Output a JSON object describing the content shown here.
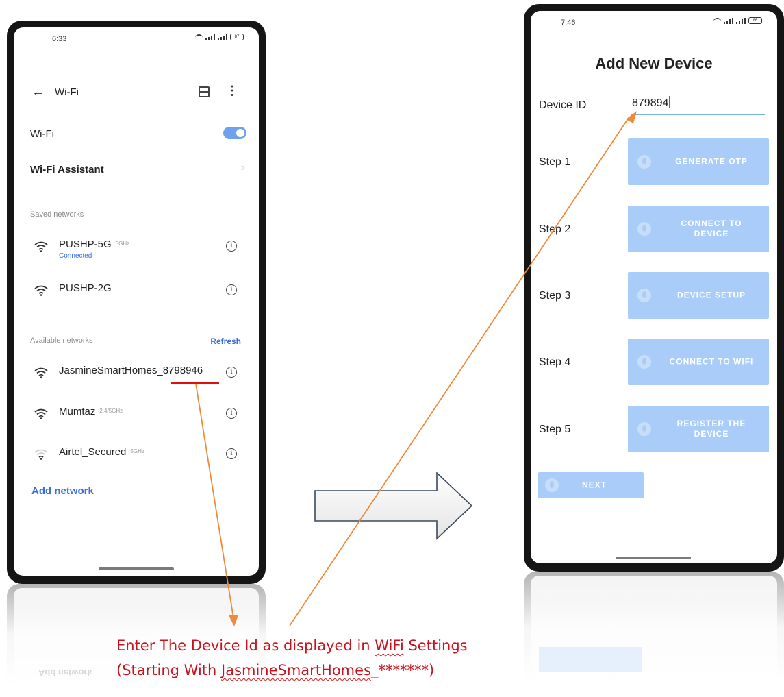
{
  "left_phone": {
    "status": {
      "time": "6:33",
      "battery": "87"
    },
    "header": {
      "title": "Wi-Fi"
    },
    "wifi_toggle_label": "Wi-Fi",
    "assistant_label": "Wi-Fi Assistant",
    "saved_section": "Saved networks",
    "saved_networks": [
      {
        "name": "PUSHP-5G",
        "band": "5GHz",
        "sub": "Connected"
      },
      {
        "name": "PUSHP-2G",
        "band": "",
        "sub": ""
      }
    ],
    "available_section": "Available networks",
    "refresh_label": "Refresh",
    "available_networks": [
      {
        "name": "JasmineSmartHomes_8798946",
        "band": ""
      },
      {
        "name": "Mumtaz",
        "band": "2.4/5GHz"
      },
      {
        "name": "Airtel_Secured",
        "band": "5GHz"
      }
    ],
    "add_network": "Add network",
    "reflection_text": "Add network"
  },
  "right_phone": {
    "status": {
      "time": "7:46",
      "battery": "86"
    },
    "title": "Add New Device",
    "device_id_label": "Device ID",
    "device_id_value": "879894",
    "steps": [
      {
        "label": "Step 1",
        "button": "GENERATE OTP"
      },
      {
        "label": "Step 2",
        "button": "CONNECT TO DEVICE"
      },
      {
        "label": "Step 3",
        "button": "DEVICE SETUP"
      },
      {
        "label": "Step 4",
        "button": "CONNECT TO WIFI"
      },
      {
        "label": "Step 5",
        "button": "REGISTER THE DEVICE"
      }
    ],
    "next_button": "NEXT",
    "reflection_text": "NEXT"
  },
  "annotation": {
    "line1_pre": "Enter The Device Id as displayed in ",
    "line1_wavy": "WiFi",
    "line1_post": " Settings",
    "line2_pre": "(Starting With ",
    "line2_wavy": "JasmineSmartHomes",
    "line2_post": "_*******)"
  },
  "colors": {
    "phone_frame": "#151515",
    "link_blue": "#3a6fd8",
    "button_blue": "#a9cdf8",
    "annotation_red": "#c8141e",
    "arrow_orange": "#f08a3a"
  }
}
